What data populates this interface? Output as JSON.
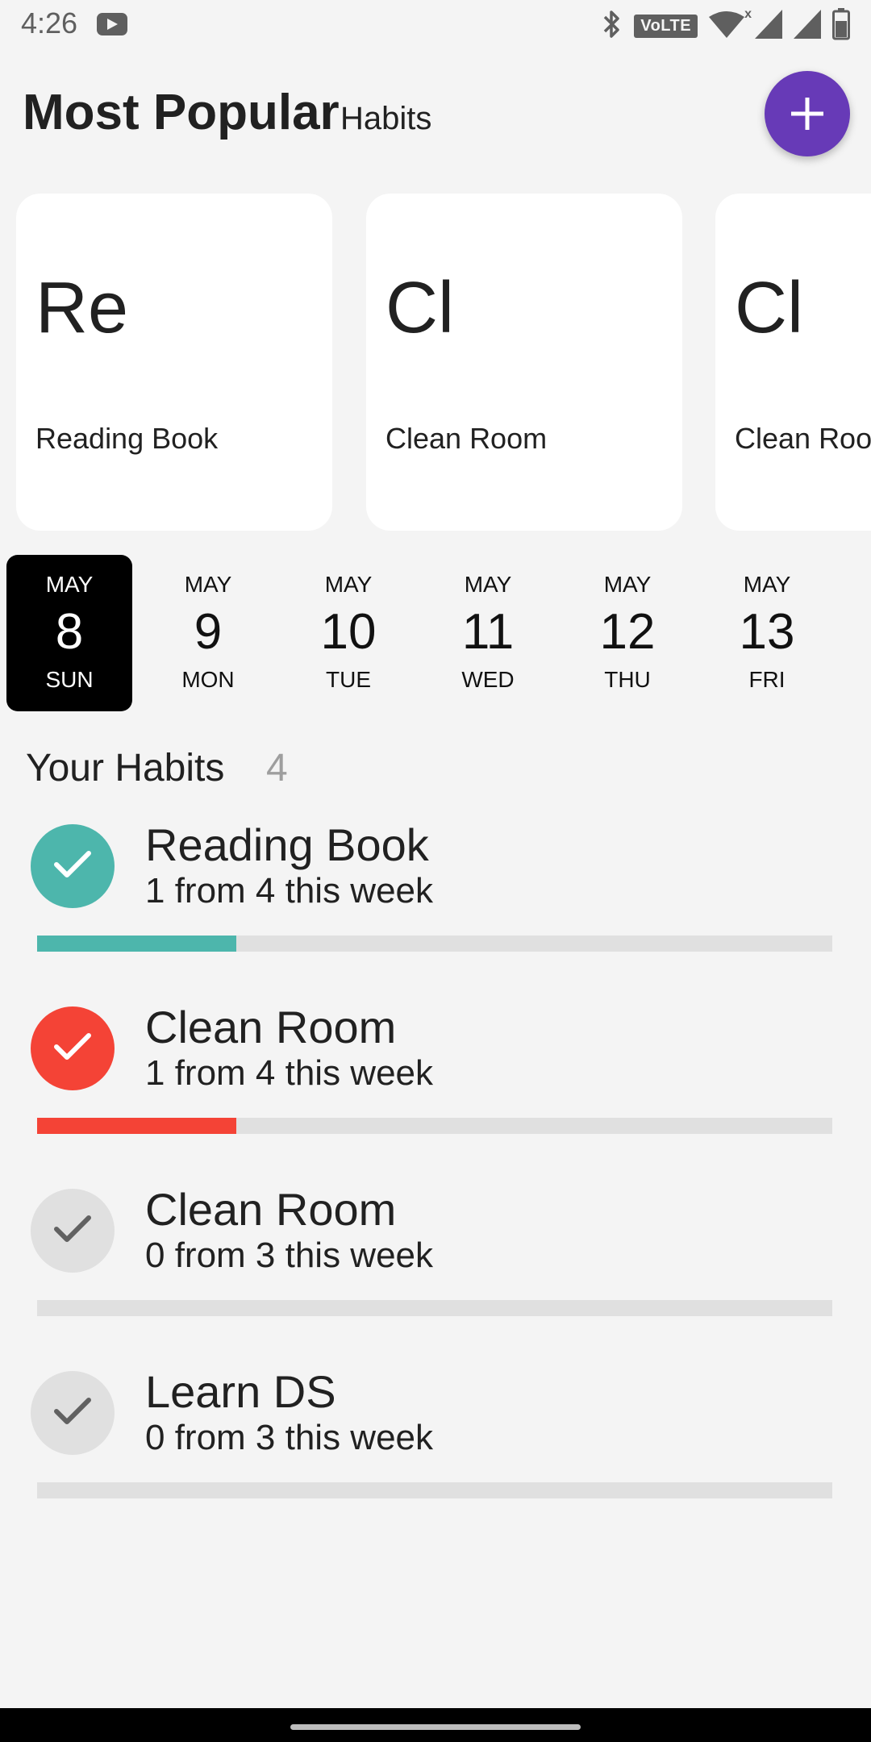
{
  "status_bar": {
    "time": "4:26",
    "network_badge": "VoLTE",
    "wifi_badge": "x",
    "icons": [
      "youtube-icon",
      "bluetooth-icon",
      "volte-icon",
      "wifi-icon",
      "signal-icon",
      "battery-icon"
    ]
  },
  "header": {
    "title": "Most Popular",
    "subtitle": "Habits",
    "add_button_icon": "plus-icon"
  },
  "popular": [
    {
      "abbr": "Re",
      "name": "Reading Book"
    },
    {
      "abbr": "Cl",
      "name": "Clean Room"
    },
    {
      "abbr": "Cl",
      "name": "Clean Room"
    }
  ],
  "dates": [
    {
      "month": "MAY",
      "day": "8",
      "weekday": "SUN",
      "selected": true
    },
    {
      "month": "MAY",
      "day": "9",
      "weekday": "MON",
      "selected": false
    },
    {
      "month": "MAY",
      "day": "10",
      "weekday": "TUE",
      "selected": false
    },
    {
      "month": "MAY",
      "day": "11",
      "weekday": "WED",
      "selected": false
    },
    {
      "month": "MAY",
      "day": "12",
      "weekday": "THU",
      "selected": false
    },
    {
      "month": "MAY",
      "day": "13",
      "weekday": "FRI",
      "selected": false
    }
  ],
  "your_habits": {
    "title": "Your Habits",
    "count": "4",
    "items": [
      {
        "name": "Reading Book",
        "progress_text": "1 from 4 this week",
        "done": 1,
        "goal": 4,
        "checked": true,
        "color": "#4db6ac"
      },
      {
        "name": "Clean Room",
        "progress_text": "1 from 4 this week",
        "done": 1,
        "goal": 4,
        "checked": true,
        "color": "#f44336"
      },
      {
        "name": "Clean Room",
        "progress_text": "0 from 3 this week",
        "done": 0,
        "goal": 3,
        "checked": false,
        "color": "#e0e0e0"
      },
      {
        "name": "Learn DS",
        "progress_text": "0 from 3 this week",
        "done": 0,
        "goal": 3,
        "checked": false,
        "color": "#e0e0e0"
      }
    ]
  },
  "colors": {
    "accent": "#673ab7",
    "background": "#f4f4f4",
    "selected_date": "#000000",
    "bar_track": "#e0e0e0"
  }
}
